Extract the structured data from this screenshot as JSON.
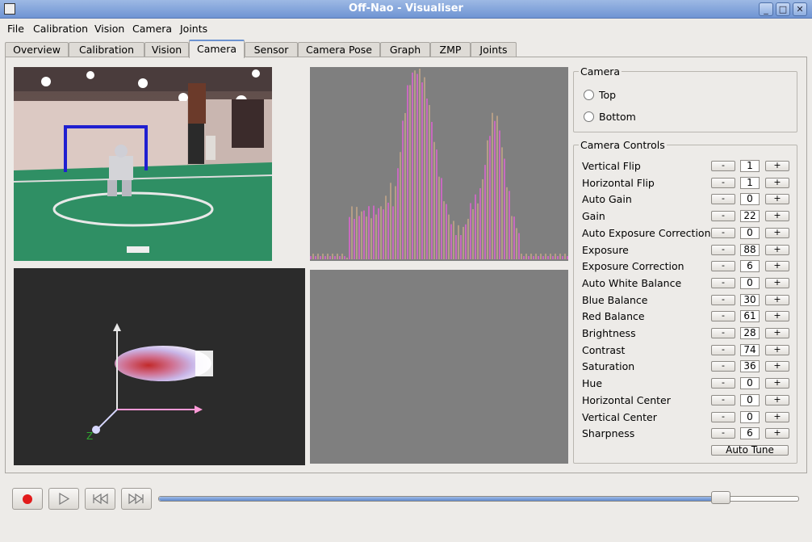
{
  "window": {
    "title": "Off-Nao - Visualiser"
  },
  "menu": [
    "File",
    "Calibration",
    "Vision",
    "Camera",
    "Joints"
  ],
  "tabs": [
    "Overview",
    "Calibration",
    "Vision",
    "Camera",
    "Sensor",
    "Camera Pose",
    "Graph",
    "ZMP",
    "Joints"
  ],
  "active_tab": "Camera",
  "camera_group": {
    "title": "Camera",
    "options": [
      "Top",
      "Bottom"
    ]
  },
  "controls_group": {
    "title": "Camera Controls",
    "controls": [
      {
        "label": "Vertical Flip",
        "value": "1"
      },
      {
        "label": "Horizontal Flip",
        "value": "1"
      },
      {
        "label": "Auto Gain",
        "value": "0"
      },
      {
        "label": "Gain",
        "value": "22"
      },
      {
        "label": "Auto Exposure Correction",
        "value": "0"
      },
      {
        "label": "Exposure",
        "value": "88"
      },
      {
        "label": "Exposure Correction",
        "value": "6"
      },
      {
        "label": "Auto White Balance",
        "value": "0"
      },
      {
        "label": "Blue Balance",
        "value": "30"
      },
      {
        "label": "Red Balance",
        "value": "61"
      },
      {
        "label": "Brightness",
        "value": "28"
      },
      {
        "label": "Contrast",
        "value": "74"
      },
      {
        "label": "Saturation",
        "value": "36"
      },
      {
        "label": "Hue",
        "value": "0"
      },
      {
        "label": "Horizontal Center",
        "value": "0"
      },
      {
        "label": "Vertical Center",
        "value": "0"
      },
      {
        "label": "Sharpness",
        "value": "6"
      }
    ],
    "minus_label": "-",
    "plus_label": "+",
    "auto_tune_label": "Auto Tune"
  },
  "axes_labels": {
    "z": "Z"
  },
  "playback": {
    "position_fraction": 0.89
  },
  "colors": {
    "accent": "#6c93d1",
    "record": "#e21b1b",
    "field": "#2f8f64"
  }
}
